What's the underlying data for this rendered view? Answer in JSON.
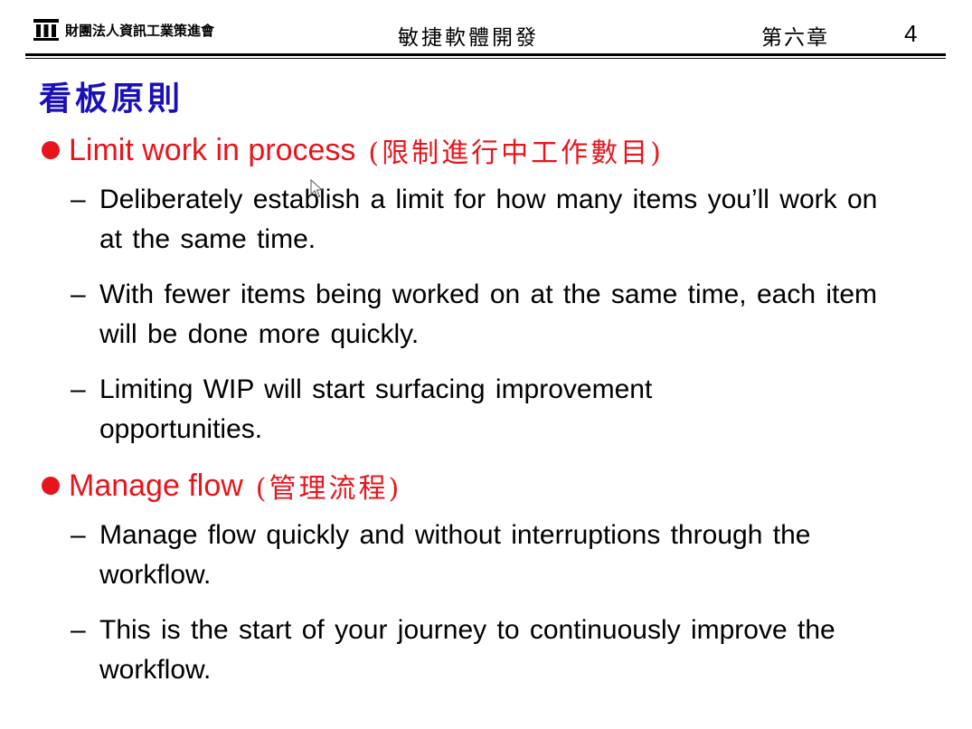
{
  "header": {
    "org_name": "財團法人資訊工業策進會",
    "course_title": "敏捷軟體開發",
    "chapter": "第六章",
    "page_number": "4"
  },
  "slide": {
    "title": "看板原則",
    "accent_color": "#e8141c",
    "title_color": "#1a10b8",
    "bullets": [
      {
        "label": "Limit work in process",
        "label_cjk": "(限制進行中工作數目)",
        "items": [
          "Deliberately establish a limit for how many items you’ll work on at the same time.",
          "With fewer items being worked on at the same time, each item will be done more quickly.",
          "Limiting WIP will start surfacing improvement opportunities."
        ]
      },
      {
        "label": "Manage flow",
        "label_cjk": "(管理流程)",
        "items": [
          "Manage flow quickly and without interruptions through the workflow.",
          "This is the start of your journey to continuously improve the workflow."
        ]
      }
    ]
  },
  "icons": {
    "logo": "building-columns-icon",
    "cursor": "mouse-pointer-icon",
    "bullet": "filled-circle-icon",
    "sub_bullet": "dash"
  }
}
